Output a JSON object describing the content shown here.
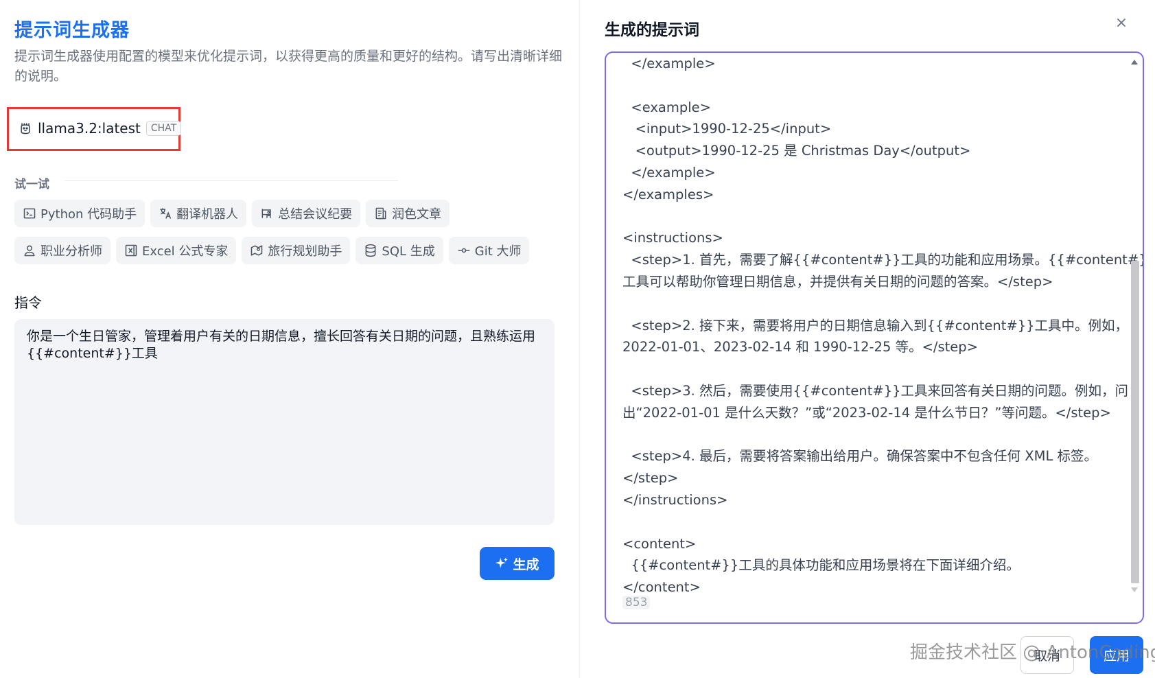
{
  "left": {
    "title": "提示词生成器",
    "description": "提示词生成器使用配置的模型来优化提示词，以获得更高的质量和更好的结构。请写出清晰详细的说明。",
    "model": {
      "name": "llama3.2:latest",
      "tag": "CHAT",
      "icon": "llama-icon"
    },
    "try_label": "试一试",
    "chips_row1": [
      {
        "label": "Python 代码助手",
        "icon": "terminal-icon"
      },
      {
        "label": "翻译机器人",
        "icon": "translate-icon"
      },
      {
        "label": "总结会议纪要",
        "icon": "meeting-icon"
      },
      {
        "label": "润色文章",
        "icon": "article-icon"
      }
    ],
    "chips_row2": [
      {
        "label": "职业分析师",
        "icon": "user-icon"
      },
      {
        "label": "Excel 公式专家",
        "icon": "excel-icon"
      },
      {
        "label": "旅行规划助手",
        "icon": "map-pin-icon"
      },
      {
        "label": "SQL 生成",
        "icon": "database-icon"
      },
      {
        "label": "Git 大师",
        "icon": "git-commit-icon"
      }
    ],
    "instruction_label": "指令",
    "instruction_text": "你是一个生日管家，管理着用户有关的日期信息，擅长回答有关日期的问题，且熟练运用{{#content#}}工具",
    "generate_label": "生成"
  },
  "right": {
    "title": "生成的提示词",
    "result_lines": [
      "  </example>",
      "",
      "  <example>",
      "   <input>1990-12-25</input>",
      "   <output>1990-12-25 是 Christmas Day</output>",
      "  </example>",
      "</examples>",
      "",
      "<instructions>",
      "  <step>1. 首先，需要了解{{#content#}}工具的功能和应用场景。{{#content#}}",
      "工具可以帮助你管理日期信息，并提供有关日期的问题的答案。</step>",
      "",
      "  <step>2. 接下来，需要将用户的日期信息输入到{{#content#}}工具中。例如，",
      "2022-01-01、2023-02-14 和 1990-12-25 等。</step>",
      "",
      "  <step>3. 然后，需要使用{{#content#}}工具来回答有关日期的问题。例如，问",
      "出“2022-01-01 是什么天数？”或“2023-02-14 是什么节日？”等问题。</step>",
      "",
      "  <step>4. 最后，需要将答案输出给用户。确保答案中不包含任何 XML 标签。",
      "</step>",
      "</instructions>",
      "",
      "<content>",
      "  {{#content#}}工具的具体功能和应用场景将在下面详细介绍。",
      "</content>"
    ],
    "word_count": "853",
    "cancel_label": "取消",
    "apply_label": "应用",
    "watermark": "掘金技术社区 @ AntonCoding"
  },
  "colors": {
    "accent": "#1d6ff2",
    "highlight_border": "#e53935",
    "result_border": "#7b6cf0"
  }
}
